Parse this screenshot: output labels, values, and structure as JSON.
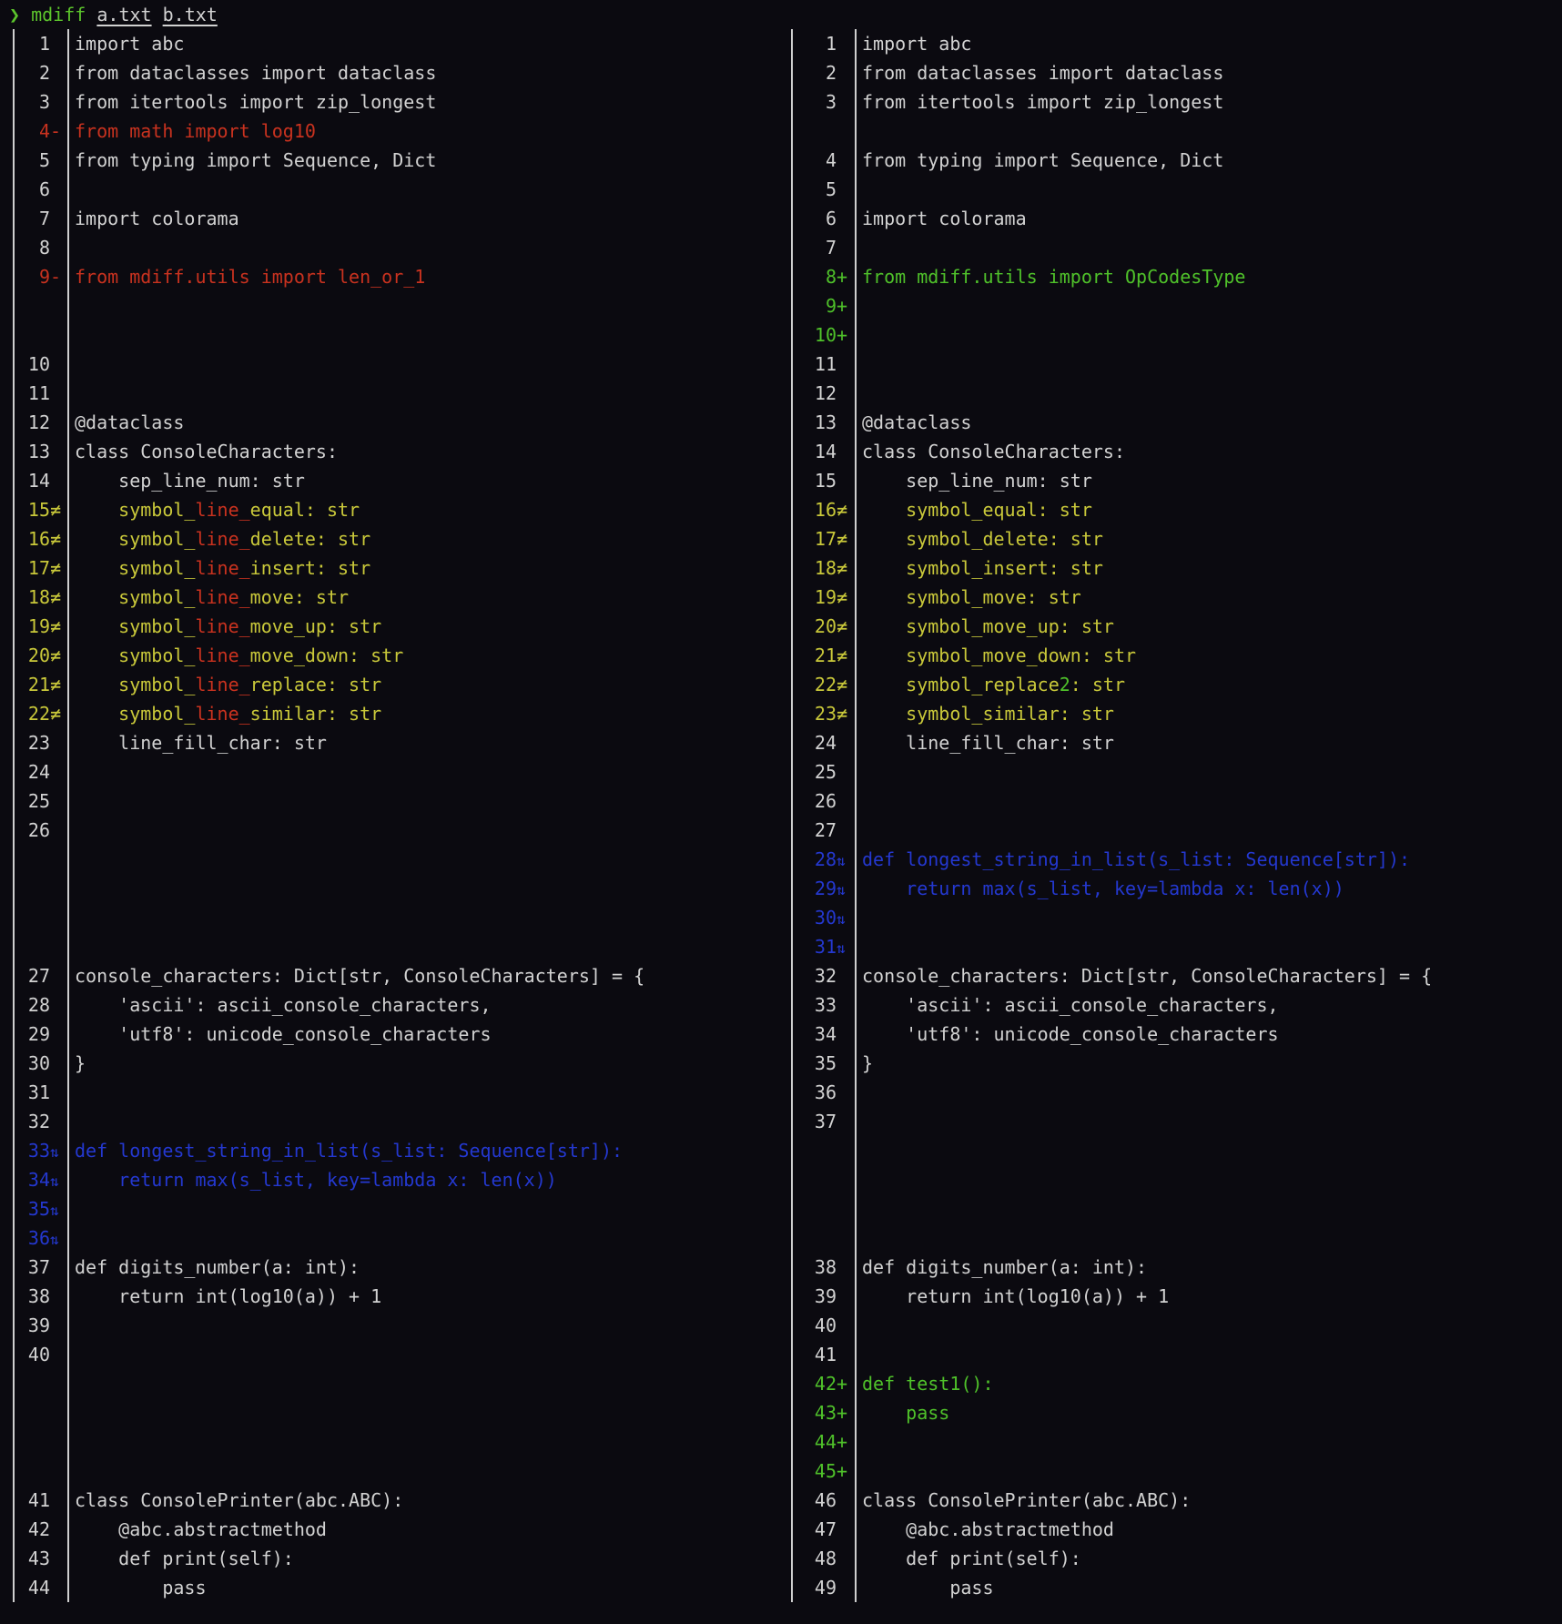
{
  "header": {
    "prompt": "❯",
    "command": "mdiff",
    "file_a": "a.txt",
    "file_b": "b.txt"
  },
  "colors": {
    "background": "#0b0a10",
    "text": "#d2d2d2",
    "delete": "#c9321f",
    "insert": "#4fc12a",
    "change": "#c9c83a",
    "move": "#2438d0"
  },
  "left": [
    {
      "n": "1",
      "m": "",
      "k": "n",
      "t": "import abc"
    },
    {
      "n": "2",
      "m": "",
      "k": "n",
      "t": "from dataclasses import dataclass"
    },
    {
      "n": "3",
      "m": "",
      "k": "n",
      "t": "from itertools import zip_longest"
    },
    {
      "n": "4",
      "m": "-",
      "k": "del",
      "t": "from math import log10"
    },
    {
      "n": "5",
      "m": "",
      "k": "n",
      "t": "from typing import Sequence, Dict"
    },
    {
      "n": "6",
      "m": "",
      "k": "n",
      "t": ""
    },
    {
      "n": "7",
      "m": "",
      "k": "n",
      "t": "import colorama"
    },
    {
      "n": "8",
      "m": "",
      "k": "n",
      "t": ""
    },
    {
      "n": "9",
      "m": "-",
      "k": "del",
      "t": "from mdiff.utils import len_or_1"
    },
    {
      "n": "",
      "m": "",
      "k": "n",
      "t": ""
    },
    {
      "n": "",
      "m": "",
      "k": "n",
      "t": ""
    },
    {
      "n": "10",
      "m": "",
      "k": "n",
      "t": ""
    },
    {
      "n": "11",
      "m": "",
      "k": "n",
      "t": ""
    },
    {
      "n": "12",
      "m": "",
      "k": "n",
      "t": "@dataclass"
    },
    {
      "n": "13",
      "m": "",
      "k": "n",
      "t": "class ConsoleCharacters:"
    },
    {
      "n": "14",
      "m": "",
      "k": "n",
      "t": "    sep_line_num: str"
    },
    {
      "n": "15",
      "m": "≠",
      "k": "chg",
      "seg": [
        [
          "    symbol_",
          "chg"
        ],
        [
          "line_",
          "del"
        ],
        [
          "equal: str",
          "chg"
        ]
      ]
    },
    {
      "n": "16",
      "m": "≠",
      "k": "chg",
      "seg": [
        [
          "    symbol_",
          "chg"
        ],
        [
          "line_",
          "del"
        ],
        [
          "delete: str",
          "chg"
        ]
      ]
    },
    {
      "n": "17",
      "m": "≠",
      "k": "chg",
      "seg": [
        [
          "    symbol_",
          "chg"
        ],
        [
          "line_",
          "del"
        ],
        [
          "insert: str",
          "chg"
        ]
      ]
    },
    {
      "n": "18",
      "m": "≠",
      "k": "chg",
      "seg": [
        [
          "    symbol_",
          "chg"
        ],
        [
          "line_",
          "del"
        ],
        [
          "move: str",
          "chg"
        ]
      ]
    },
    {
      "n": "19",
      "m": "≠",
      "k": "chg",
      "seg": [
        [
          "    symbol_",
          "chg"
        ],
        [
          "line_",
          "del"
        ],
        [
          "move_up: str",
          "chg"
        ]
      ]
    },
    {
      "n": "20",
      "m": "≠",
      "k": "chg",
      "seg": [
        [
          "    symbol_",
          "chg"
        ],
        [
          "line_",
          "del"
        ],
        [
          "move_down: str",
          "chg"
        ]
      ]
    },
    {
      "n": "21",
      "m": "≠",
      "k": "chg",
      "seg": [
        [
          "    symbol_",
          "chg"
        ],
        [
          "line_",
          "del"
        ],
        [
          "replace: str",
          "chg"
        ]
      ]
    },
    {
      "n": "22",
      "m": "≠",
      "k": "chg",
      "seg": [
        [
          "    symbol_",
          "chg"
        ],
        [
          "line_",
          "del"
        ],
        [
          "similar: str",
          "chg"
        ]
      ]
    },
    {
      "n": "23",
      "m": "",
      "k": "n",
      "t": "    line_fill_char: str"
    },
    {
      "n": "24",
      "m": "",
      "k": "n",
      "t": ""
    },
    {
      "n": "25",
      "m": "",
      "k": "n",
      "t": ""
    },
    {
      "n": "26",
      "m": "",
      "k": "n",
      "t": ""
    },
    {
      "n": "",
      "m": "",
      "k": "n",
      "t": ""
    },
    {
      "n": "",
      "m": "",
      "k": "n",
      "t": ""
    },
    {
      "n": "",
      "m": "",
      "k": "n",
      "t": ""
    },
    {
      "n": "",
      "m": "",
      "k": "n",
      "t": ""
    },
    {
      "n": "27",
      "m": "",
      "k": "n",
      "t": "console_characters: Dict[str, ConsoleCharacters] = {"
    },
    {
      "n": "28",
      "m": "",
      "k": "n",
      "t": "    'ascii': ascii_console_characters,"
    },
    {
      "n": "29",
      "m": "",
      "k": "n",
      "t": "    'utf8': unicode_console_characters"
    },
    {
      "n": "30",
      "m": "",
      "k": "n",
      "t": "}"
    },
    {
      "n": "31",
      "m": "",
      "k": "n",
      "t": ""
    },
    {
      "n": "32",
      "m": "",
      "k": "n",
      "t": ""
    },
    {
      "n": "33",
      "m": "⇅",
      "k": "mov",
      "t": "def longest_string_in_list(s_list: Sequence[str]):"
    },
    {
      "n": "34",
      "m": "⇅",
      "k": "mov",
      "t": "    return max(s_list, key=lambda x: len(x))"
    },
    {
      "n": "35",
      "m": "⇅",
      "k": "mov",
      "t": ""
    },
    {
      "n": "36",
      "m": "⇅",
      "k": "mov",
      "t": ""
    },
    {
      "n": "37",
      "m": "",
      "k": "n",
      "t": "def digits_number(a: int):"
    },
    {
      "n": "38",
      "m": "",
      "k": "n",
      "t": "    return int(log10(a)) + 1"
    },
    {
      "n": "39",
      "m": "",
      "k": "n",
      "t": ""
    },
    {
      "n": "40",
      "m": "",
      "k": "n",
      "t": ""
    },
    {
      "n": "",
      "m": "",
      "k": "n",
      "t": ""
    },
    {
      "n": "",
      "m": "",
      "k": "n",
      "t": ""
    },
    {
      "n": "",
      "m": "",
      "k": "n",
      "t": ""
    },
    {
      "n": "",
      "m": "",
      "k": "n",
      "t": ""
    },
    {
      "n": "41",
      "m": "",
      "k": "n",
      "t": "class ConsolePrinter(abc.ABC):"
    },
    {
      "n": "42",
      "m": "",
      "k": "n",
      "t": "    @abc.abstractmethod"
    },
    {
      "n": "43",
      "m": "",
      "k": "n",
      "t": "    def print(self):"
    },
    {
      "n": "44",
      "m": "",
      "k": "n",
      "t": "        pass"
    }
  ],
  "right": [
    {
      "n": "1",
      "m": "",
      "k": "n",
      "t": "import abc"
    },
    {
      "n": "2",
      "m": "",
      "k": "n",
      "t": "from dataclasses import dataclass"
    },
    {
      "n": "3",
      "m": "",
      "k": "n",
      "t": "from itertools import zip_longest"
    },
    {
      "n": "",
      "m": "",
      "k": "n",
      "t": ""
    },
    {
      "n": "4",
      "m": "",
      "k": "n",
      "t": "from typing import Sequence, Dict"
    },
    {
      "n": "5",
      "m": "",
      "k": "n",
      "t": ""
    },
    {
      "n": "6",
      "m": "",
      "k": "n",
      "t": "import colorama"
    },
    {
      "n": "7",
      "m": "",
      "k": "n",
      "t": ""
    },
    {
      "n": "8",
      "m": "+",
      "k": "ins",
      "t": "from mdiff.utils import OpCodesType"
    },
    {
      "n": "9",
      "m": "+",
      "k": "ins",
      "t": ""
    },
    {
      "n": "10",
      "m": "+",
      "k": "ins",
      "t": ""
    },
    {
      "n": "11",
      "m": "",
      "k": "n",
      "t": ""
    },
    {
      "n": "12",
      "m": "",
      "k": "n",
      "t": ""
    },
    {
      "n": "13",
      "m": "",
      "k": "n",
      "t": "@dataclass"
    },
    {
      "n": "14",
      "m": "",
      "k": "n",
      "t": "class ConsoleCharacters:"
    },
    {
      "n": "15",
      "m": "",
      "k": "n",
      "t": "    sep_line_num: str"
    },
    {
      "n": "16",
      "m": "≠",
      "k": "chg",
      "t": "    symbol_equal: str"
    },
    {
      "n": "17",
      "m": "≠",
      "k": "chg",
      "t": "    symbol_delete: str"
    },
    {
      "n": "18",
      "m": "≠",
      "k": "chg",
      "t": "    symbol_insert: str"
    },
    {
      "n": "19",
      "m": "≠",
      "k": "chg",
      "t": "    symbol_move: str"
    },
    {
      "n": "20",
      "m": "≠",
      "k": "chg",
      "t": "    symbol_move_up: str"
    },
    {
      "n": "21",
      "m": "≠",
      "k": "chg",
      "t": "    symbol_move_down: str"
    },
    {
      "n": "22",
      "m": "≠",
      "k": "chg",
      "seg": [
        [
          "    symbol_replace",
          "chg"
        ],
        [
          "2",
          "ins"
        ],
        [
          ": str",
          "chg"
        ]
      ]
    },
    {
      "n": "23",
      "m": "≠",
      "k": "chg",
      "t": "    symbol_similar: str"
    },
    {
      "n": "24",
      "m": "",
      "k": "n",
      "t": "    line_fill_char: str"
    },
    {
      "n": "25",
      "m": "",
      "k": "n",
      "t": ""
    },
    {
      "n": "26",
      "m": "",
      "k": "n",
      "t": ""
    },
    {
      "n": "27",
      "m": "",
      "k": "n",
      "t": ""
    },
    {
      "n": "28",
      "m": "⇅",
      "k": "mov",
      "t": "def longest_string_in_list(s_list: Sequence[str]):"
    },
    {
      "n": "29",
      "m": "⇅",
      "k": "mov",
      "t": "    return max(s_list, key=lambda x: len(x))"
    },
    {
      "n": "30",
      "m": "⇅",
      "k": "mov",
      "t": ""
    },
    {
      "n": "31",
      "m": "⇅",
      "k": "mov",
      "t": ""
    },
    {
      "n": "32",
      "m": "",
      "k": "n",
      "t": "console_characters: Dict[str, ConsoleCharacters] = {"
    },
    {
      "n": "33",
      "m": "",
      "k": "n",
      "t": "    'ascii': ascii_console_characters,"
    },
    {
      "n": "34",
      "m": "",
      "k": "n",
      "t": "    'utf8': unicode_console_characters"
    },
    {
      "n": "35",
      "m": "",
      "k": "n",
      "t": "}"
    },
    {
      "n": "36",
      "m": "",
      "k": "n",
      "t": ""
    },
    {
      "n": "37",
      "m": "",
      "k": "n",
      "t": ""
    },
    {
      "n": "",
      "m": "",
      "k": "n",
      "t": ""
    },
    {
      "n": "",
      "m": "",
      "k": "n",
      "t": ""
    },
    {
      "n": "",
      "m": "",
      "k": "n",
      "t": ""
    },
    {
      "n": "",
      "m": "",
      "k": "n",
      "t": ""
    },
    {
      "n": "38",
      "m": "",
      "k": "n",
      "t": "def digits_number(a: int):"
    },
    {
      "n": "39",
      "m": "",
      "k": "n",
      "t": "    return int(log10(a)) + 1"
    },
    {
      "n": "40",
      "m": "",
      "k": "n",
      "t": ""
    },
    {
      "n": "41",
      "m": "",
      "k": "n",
      "t": ""
    },
    {
      "n": "42",
      "m": "+",
      "k": "ins",
      "t": "def test1():"
    },
    {
      "n": "43",
      "m": "+",
      "k": "ins",
      "t": "    pass"
    },
    {
      "n": "44",
      "m": "+",
      "k": "ins",
      "t": ""
    },
    {
      "n": "45",
      "m": "+",
      "k": "ins",
      "t": ""
    },
    {
      "n": "46",
      "m": "",
      "k": "n",
      "t": "class ConsolePrinter(abc.ABC):"
    },
    {
      "n": "47",
      "m": "",
      "k": "n",
      "t": "    @abc.abstractmethod"
    },
    {
      "n": "48",
      "m": "",
      "k": "n",
      "t": "    def print(self):"
    },
    {
      "n": "49",
      "m": "",
      "k": "n",
      "t": "        pass"
    }
  ]
}
